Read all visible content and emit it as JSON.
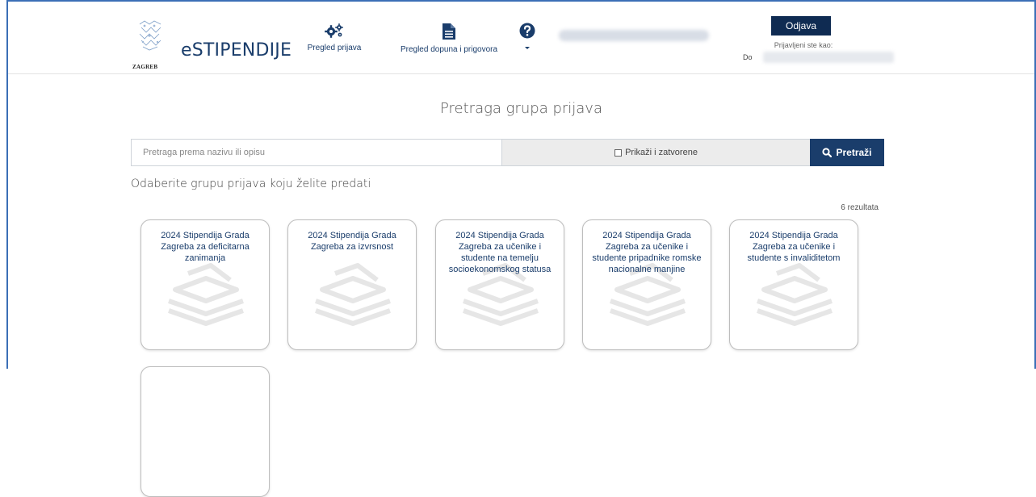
{
  "header": {
    "logo_city": "ZAGREB",
    "brand": "eSTIPENDIJE",
    "nav": [
      {
        "label": "Pregled prijava",
        "icon": "gears-icon"
      },
      {
        "label": "Pregled dopuna i prigovora",
        "icon": "document-icon"
      },
      {
        "label": "",
        "icon": "help-icon"
      }
    ],
    "logout_label": "Odjava",
    "logged_in_label": "Prijavljeni ste kao:",
    "logged_row_prefix": "Do"
  },
  "page": {
    "title": "Pretraga grupa prijava",
    "choose_text": "Odaberite grupu prijava koju želite predati",
    "results_count": "6 rezultata"
  },
  "search": {
    "placeholder": "Pretraga prema nazivu ili opisu",
    "value": "",
    "show_closed_label": "Prikaži i zatvorene",
    "show_closed_checked": false,
    "button_label": "Pretraži"
  },
  "cards": [
    {
      "title": "2024 Stipendija Grada Zagreba za deficitarna zanimanja"
    },
    {
      "title": "2024 Stipendija Grada Zagreba za izvrsnost"
    },
    {
      "title": "2024 Stipendija Grada Zagreba za učenike i studente na temelju socioekonomskog statusa"
    },
    {
      "title": "2024 Stipendija Grada Zagreba za učenike i studente pripadnike romske nacionalne manjine"
    },
    {
      "title": "2024 Stipendija Grada Zagreba za učenike i studente s invaliditetom"
    }
  ],
  "colors": {
    "brand_blue": "#1a3d6b",
    "logout_bg": "#0f2b52",
    "frame_border": "#3b6fb6"
  }
}
